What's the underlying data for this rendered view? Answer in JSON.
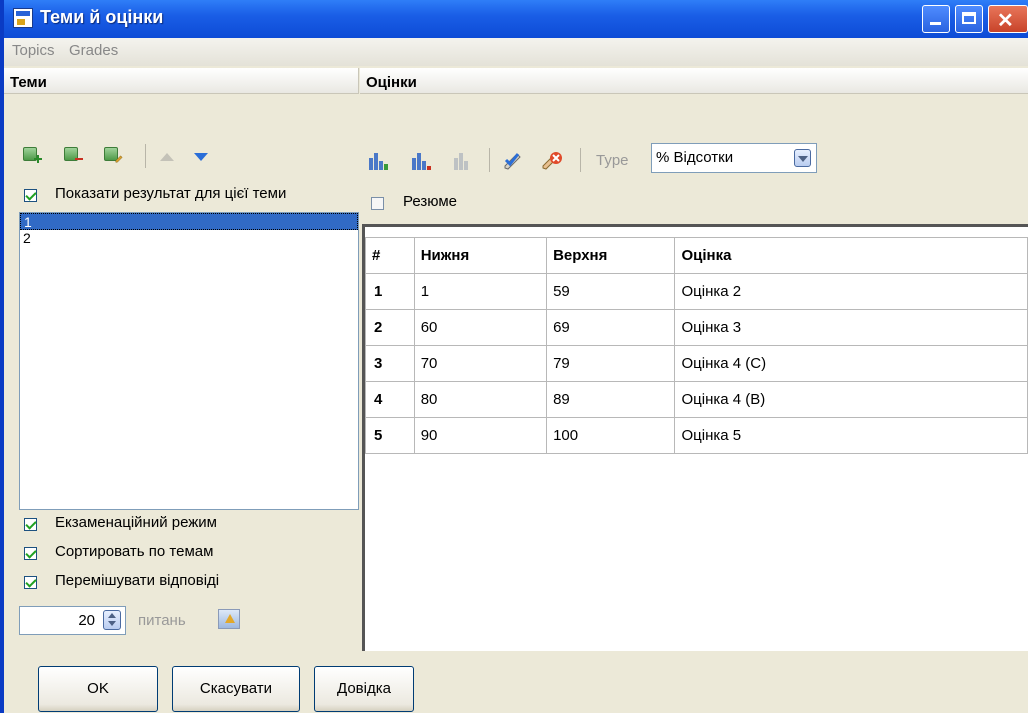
{
  "window": {
    "title": "Теми й оцінки"
  },
  "menu": {
    "items": [
      "Topics",
      "Grades"
    ]
  },
  "topics": {
    "header": "Теми",
    "show_result_label": "Показати результат для цієї теми",
    "items": [
      "1",
      "2"
    ],
    "selected_index": 0,
    "exam_mode_label": "Екзаменаційний режим",
    "sort_by_topics_label": "Сортировать по темам",
    "shuffle_answers_label": "Перемішувати відповіді",
    "question_count": "20",
    "questions_label": "питань"
  },
  "grades": {
    "header": "Оцінки",
    "type_label": "Type",
    "type_value": "% Відсотки",
    "resume_label": "Резюме",
    "resume_checked": false,
    "columns": [
      "#",
      "Нижня",
      "Верхня",
      "Оцінка"
    ],
    "rows": [
      [
        "1",
        "1",
        "59",
        "Оцінка 2"
      ],
      [
        "2",
        "60",
        "69",
        "Оцінка 3"
      ],
      [
        "3",
        "70",
        "79",
        "Оцінка 4 (C)"
      ],
      [
        "4",
        "80",
        "89",
        "Оцінка 4 (B)"
      ],
      [
        "5",
        "90",
        "100",
        "Оцінка 5"
      ]
    ]
  },
  "buttons": {
    "ok": "OK",
    "cancel": "Скасувати",
    "help": "Довідка"
  },
  "colors": {
    "title_bar": "#1a5ee6",
    "selection": "#316ac5",
    "check": "#21a121"
  }
}
